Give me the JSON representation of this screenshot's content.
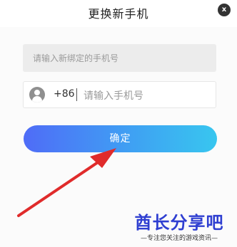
{
  "header": {
    "title": "更换新手机",
    "close_label": "x"
  },
  "form": {
    "new_phone_placeholder": "请输入新绑定的手机号",
    "country_code": "+86",
    "phone_placeholder": "请输入手机号",
    "confirm_label": "确定"
  },
  "watermark": {
    "title": "酋长分享吧",
    "subtitle": "—专注您关注的游戏资讯—"
  },
  "colors": {
    "button_gradient_start": "#4f6cf7",
    "button_gradient_end": "#38c6ef",
    "arrow": "#e02b2b",
    "watermark": "#2f3fd1"
  }
}
